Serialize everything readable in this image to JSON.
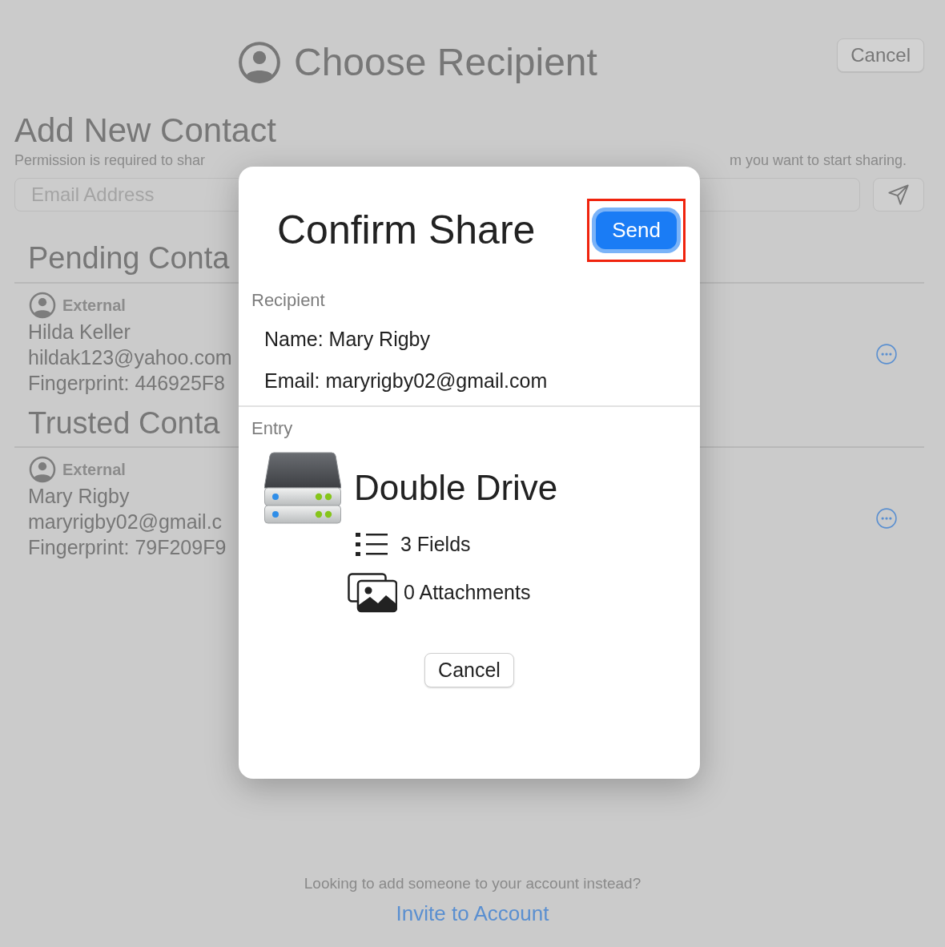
{
  "header": {
    "title": "Choose Recipient",
    "cancel_button": "Cancel"
  },
  "add_contact": {
    "title": "Add New Contact",
    "description_parts": [
      "Permission is required to shar",
      "m you want to start sharing."
    ],
    "email_field": {
      "placeholder": "Email Address"
    }
  },
  "sections": [
    {
      "title": "Pending Conta",
      "contacts": [
        {
          "type_label": "External",
          "name": "Hilda Keller",
          "email": "hildak123@yahoo.com",
          "fingerprint": "Fingerprint: 446925F8"
        }
      ]
    },
    {
      "title": "Trusted Conta",
      "contacts": [
        {
          "type_label": "External",
          "name": "Mary Rigby",
          "email": "maryrigby02@gmail.c",
          "fingerprint": "Fingerprint: 79F209F9"
        }
      ]
    }
  ],
  "footer": {
    "prompt": "Looking to add someone to your account instead?",
    "link": "Invite to Account"
  },
  "dialog": {
    "title": "Confirm Share",
    "send_button": {
      "label": "Send",
      "highlighted": true
    },
    "recipient": {
      "heading": "Recipient",
      "name_line": "Name: Mary Rigby",
      "email_line": "Email: maryrigby02@gmail.com"
    },
    "entry": {
      "heading": "Entry",
      "title": "Double Drive",
      "fields": "3 Fields",
      "attachments": "0 Attachments"
    },
    "cancel_button": "Cancel"
  }
}
